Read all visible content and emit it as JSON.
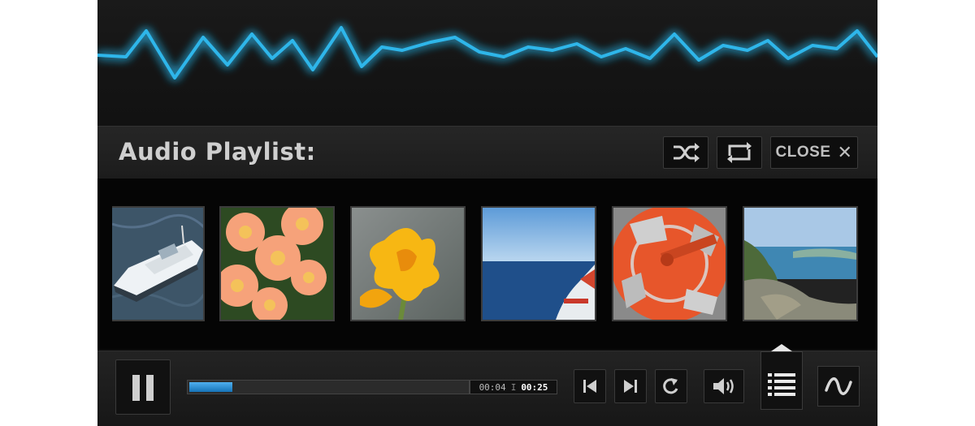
{
  "playlist": {
    "title": "Audio Playlist:",
    "shuffle_icon": "shuffle-icon",
    "repeat_icon": "repeat-icon",
    "close_label": "CLOSE",
    "close_icon": "close-icon",
    "tracks": [
      {
        "artwork": "boat"
      },
      {
        "artwork": "orange daisies"
      },
      {
        "artwork": "yellow flower"
      },
      {
        "artwork": "sea horizon"
      },
      {
        "artwork": "orange reel"
      },
      {
        "artwork": "coastline"
      }
    ]
  },
  "player": {
    "visualizer_color": "#2fb6ea",
    "current_time": "00:04",
    "separator": "I",
    "total_time": "00:25",
    "progress": 0.16,
    "icons": {
      "pause": "pause-icon",
      "previous": "skip-back-icon",
      "next": "skip-forward-icon",
      "reload": "reload-icon",
      "volume": "volume-icon",
      "playlist": "playlist-icon",
      "visualizer": "waveform-icon"
    }
  }
}
